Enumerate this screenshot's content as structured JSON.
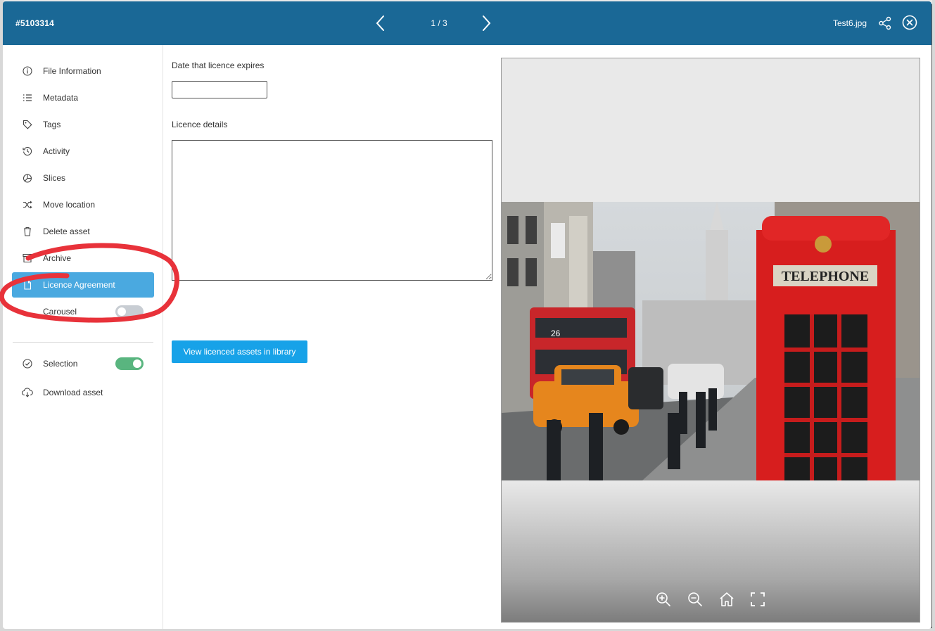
{
  "header": {
    "asset_id": "#5103314",
    "page_counter": "1 / 3",
    "file_name": "Test6.jpg"
  },
  "sidebar": {
    "items": [
      {
        "label": "File Information",
        "icon": "info-icon"
      },
      {
        "label": "Metadata",
        "icon": "list-icon"
      },
      {
        "label": "Tags",
        "icon": "tag-icon"
      },
      {
        "label": "Activity",
        "icon": "history-icon"
      },
      {
        "label": "Slices",
        "icon": "pie-icon"
      },
      {
        "label": "Move location",
        "icon": "shuffle-icon"
      },
      {
        "label": "Delete asset",
        "icon": "trash-icon"
      },
      {
        "label": "Archive",
        "icon": "archive-icon"
      },
      {
        "label": "Licence Agreement",
        "icon": "document-icon",
        "active": true
      },
      {
        "label": "Carousel",
        "toggle": false
      }
    ],
    "secondary": [
      {
        "label": "Selection",
        "icon": "check-circle-icon",
        "toggle": true
      },
      {
        "label": "Download asset",
        "icon": "cloud-download-icon"
      }
    ]
  },
  "form": {
    "date_label": "Date that licence expires",
    "date_value": "",
    "details_label": "Licence details",
    "details_value": "",
    "view_button": "View licenced assets in library"
  },
  "preview": {
    "sign_text": "TELEPHONE",
    "bus_number": "26",
    "controls": [
      "zoom-in-icon",
      "zoom-out-icon",
      "home-icon",
      "fullscreen-icon"
    ]
  },
  "colors": {
    "header": "#1a6896",
    "active_item": "#4aa9e0",
    "button": "#17a2e8",
    "toggle_on": "#59b57f",
    "annotation": "#e8323a"
  }
}
